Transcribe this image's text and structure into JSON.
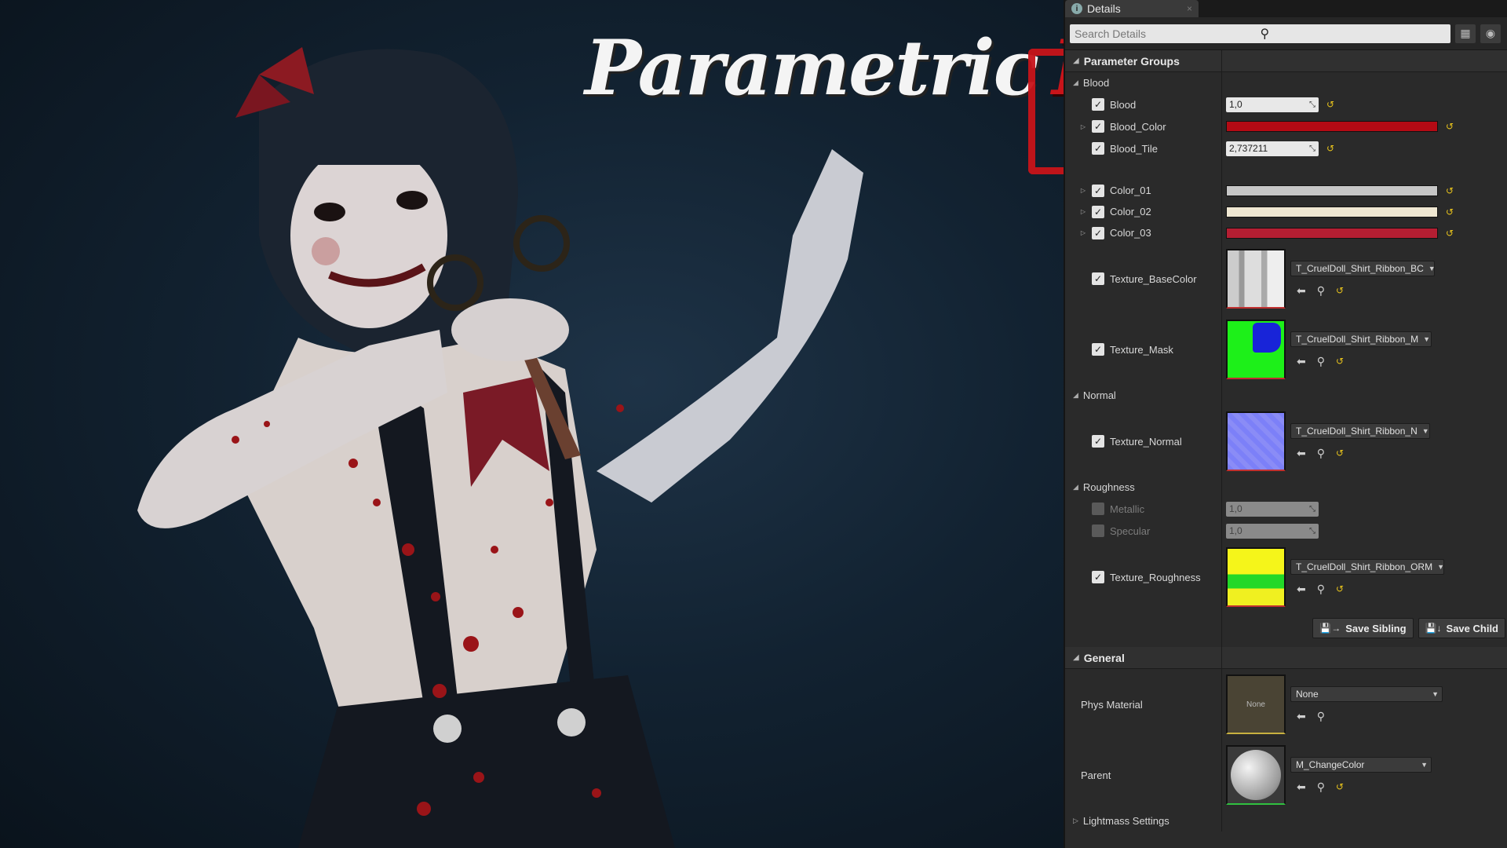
{
  "banner": {
    "word1": "Parametric",
    "word2": "Blood"
  },
  "details_tab": {
    "title": "Details",
    "info_icon": "info-icon",
    "close": "×"
  },
  "search": {
    "placeholder": "Search Details"
  },
  "parameter_groups": {
    "title": "Parameter Groups",
    "blood_group": "Blood",
    "blood": {
      "label": "Blood",
      "value": "1,0"
    },
    "blood_color": {
      "label": "Blood_Color",
      "color": "#b40a14"
    },
    "blood_tile": {
      "label": "Blood_Tile",
      "value": "2,737211"
    },
    "color_01": {
      "label": "Color_01",
      "color": "#c6c6c6"
    },
    "color_02": {
      "label": "Color_02",
      "color": "#efe7d2"
    },
    "color_03": {
      "label": "Color_03",
      "color": "#b41e32"
    },
    "texture_basecolor": {
      "label": "Texture_BaseColor",
      "asset": "T_CruelDoll_Shirt_Ribbon_BC"
    },
    "texture_mask": {
      "label": "Texture_Mask",
      "asset": "T_CruelDoll_Shirt_Ribbon_M"
    },
    "normal_group": "Normal",
    "texture_normal": {
      "label": "Texture_Normal",
      "asset": "T_CruelDoll_Shirt_Ribbon_N"
    },
    "roughness_group": "Roughness",
    "metallic": {
      "label": "Metallic",
      "value": "1,0"
    },
    "specular": {
      "label": "Specular",
      "value": "1,0"
    },
    "texture_roughness": {
      "label": "Texture_Roughness",
      "asset": "T_CruelDoll_Shirt_Ribbon_ORM"
    }
  },
  "buttons": {
    "save_sibling": "Save Sibling",
    "save_child": "Save Child"
  },
  "general": {
    "title": "General",
    "phys_material": {
      "label": "Phys Material",
      "thumb_text": "None",
      "value": "None"
    },
    "parent": {
      "label": "Parent",
      "value": "M_ChangeColor"
    },
    "lightmass": "Lightmass Settings"
  },
  "colors": {
    "accent_blood": "#c8141a",
    "reset_arrow": "#e8c31c",
    "panel_bg": "#2a2a2a"
  }
}
